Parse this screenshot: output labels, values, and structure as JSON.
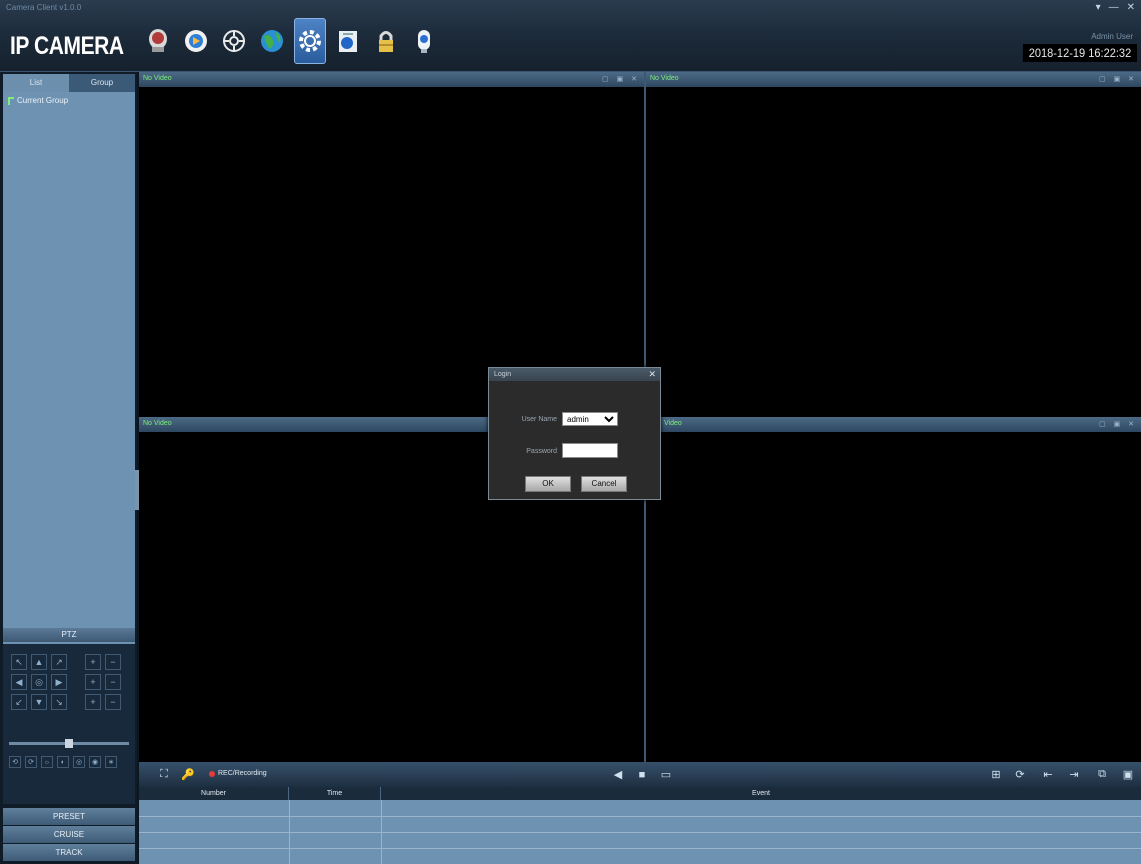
{
  "window": {
    "caption": "Camera Client v1.0.0",
    "controls": [
      "▾",
      "—",
      "✕"
    ]
  },
  "brand": "IP CAMERA",
  "toolbar": [
    {
      "name": "record-icon",
      "label": "Record"
    },
    {
      "name": "playback-icon",
      "label": "Playback"
    },
    {
      "name": "ptz-icon",
      "label": "PTZ"
    },
    {
      "name": "globe-icon",
      "label": "Network"
    },
    {
      "name": "settings-icon",
      "label": "Settings",
      "active": true
    },
    {
      "name": "log-icon",
      "label": "Log"
    },
    {
      "name": "lock-icon",
      "label": "Lock"
    },
    {
      "name": "user-icon",
      "label": "User"
    }
  ],
  "header": {
    "user_info": "Admin User",
    "datetime": "2018-12-19 16:22:32"
  },
  "left_panel": {
    "tabs": [
      "List",
      "Group"
    ],
    "tree_root": "Current Group",
    "ptz_title": "PTZ",
    "ptz_arrows": [
      "↖",
      "▲",
      "↗",
      "◀",
      "◎",
      "▶",
      "↙",
      "▼",
      "↘"
    ],
    "ptz_side": [
      "+",
      "−",
      "+",
      "−",
      "+",
      "−"
    ],
    "ptz_small": [
      "⟲",
      "⟳",
      "☼",
      "◐",
      "◎",
      "◉",
      "∗"
    ],
    "buttons": [
      "PRESET",
      "CRUISE",
      "TRACK"
    ]
  },
  "video_panes": [
    {
      "title": "No Video",
      "icons": "▢ ▣ ✕"
    },
    {
      "title": "No Video",
      "icons": "▢ ▣ ✕"
    },
    {
      "title": "No Video",
      "icons": "▢ ▣ ✕"
    },
    {
      "title": "Video",
      "icons": "▢ ▣ ✕"
    }
  ],
  "login_dialog": {
    "title": "Login",
    "close": "✕",
    "user_label": "User Name",
    "user_value": "admin",
    "password_label": "Password",
    "password_value": "",
    "ok_label": "OK",
    "cancel_label": "Cancel"
  },
  "bottom_bar": {
    "left_icons": [
      "⛶",
      "🔑"
    ],
    "record_label": "REC/Recording",
    "center_icons": [
      "◀",
      "■",
      "▭"
    ],
    "right_icons": [
      "⊞",
      "⟳",
      "⇤",
      "⇥",
      "⧉",
      "▣"
    ]
  },
  "event_log": {
    "columns": [
      "Number",
      "Time",
      "Event"
    ]
  },
  "colors": {
    "header_bg": "#1b2938",
    "panel_blue": "#6e92b1",
    "active_tool": "#4d82c4",
    "status_green": "#7df07a",
    "video_bg": "#000000"
  }
}
